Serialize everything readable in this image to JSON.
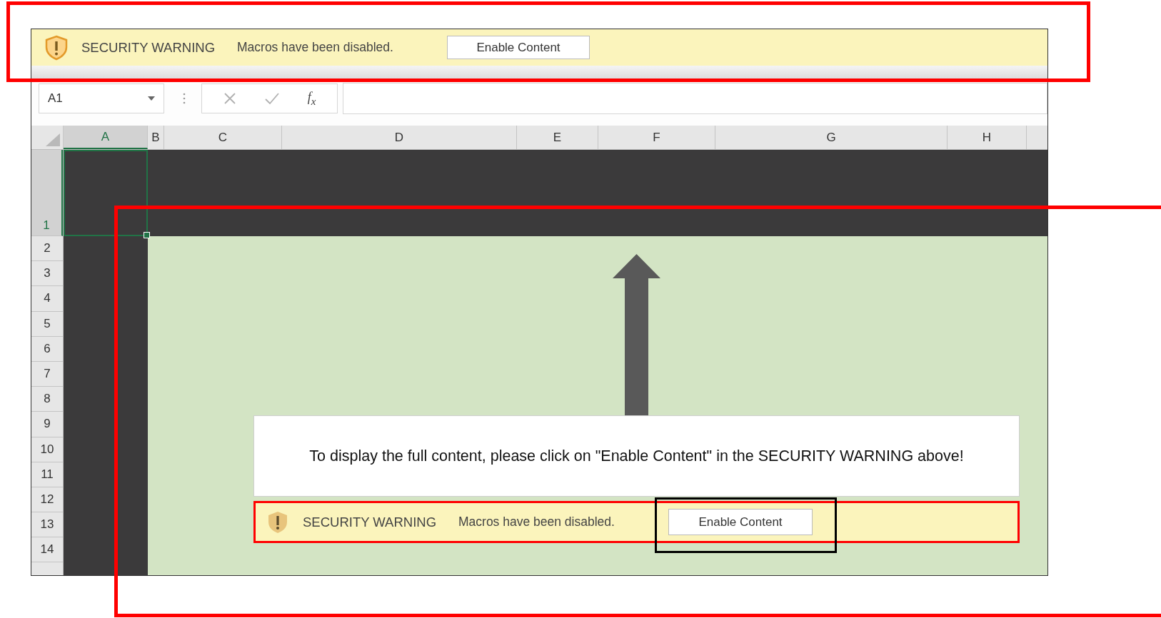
{
  "security_bar": {
    "title": "SECURITY WARNING",
    "message": "Macros have been disabled.",
    "button": "Enable Content"
  },
  "formula_bar": {
    "name_box": "A1",
    "function_label": "f$_{x}$"
  },
  "columns": [
    {
      "label": "A",
      "selected": true
    },
    {
      "label": "B",
      "selected": false
    },
    {
      "label": "C",
      "selected": false
    },
    {
      "label": "D",
      "selected": false
    },
    {
      "label": "E",
      "selected": false
    },
    {
      "label": "F",
      "selected": false
    },
    {
      "label": "G",
      "selected": false
    },
    {
      "label": "H",
      "selected": false
    }
  ],
  "rows": [
    {
      "label": "1",
      "selected": true
    },
    {
      "label": "2",
      "selected": false
    },
    {
      "label": "3",
      "selected": false
    },
    {
      "label": "4",
      "selected": false
    },
    {
      "label": "5",
      "selected": false
    },
    {
      "label": "6",
      "selected": false
    },
    {
      "label": "7",
      "selected": false
    },
    {
      "label": "8",
      "selected": false
    },
    {
      "label": "9",
      "selected": false
    },
    {
      "label": "10",
      "selected": false
    },
    {
      "label": "11",
      "selected": false
    },
    {
      "label": "12",
      "selected": false
    },
    {
      "label": "13",
      "selected": false
    },
    {
      "label": "14",
      "selected": false
    }
  ],
  "message_box": {
    "text": "To display the full content, please click on \"Enable Content\" in the SECURITY WARNING above!"
  },
  "inline_warning": {
    "title": "SECURITY WARNING",
    "message": "Macros have been disabled.",
    "button": "Enable Content"
  }
}
